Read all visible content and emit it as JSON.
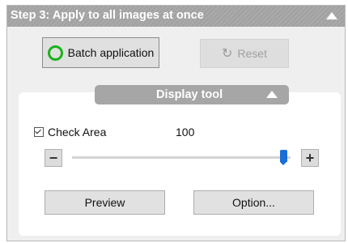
{
  "step": {
    "title": "Step 3: Apply to all images at once"
  },
  "actions": {
    "batch_label": "Batch application",
    "reset_label": "Reset"
  },
  "display_tool": {
    "title": "Display tool",
    "check_area_label": "Check Area",
    "check_area_checked": true,
    "value": "100",
    "slider_fraction": 0.97,
    "preview_label": "Preview",
    "option_label": "Option..."
  },
  "colors": {
    "header_gray": "#a6a6a6",
    "accent_blue": "#1a6fd6",
    "ring_green": "#19b319"
  }
}
